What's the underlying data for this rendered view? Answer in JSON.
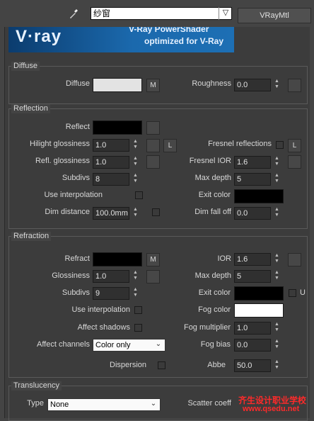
{
  "header": {
    "material_name": "纱窗",
    "material_type": "VRayMtl"
  },
  "banner": {
    "logo": "V·ray",
    "top_text": "V-Ray PowerShader",
    "subtitle": "optimized for V-Ray"
  },
  "diffuse": {
    "title": "Diffuse",
    "diffuse_label": "Diffuse",
    "diffuse_map": "M",
    "roughness_label": "Roughness",
    "roughness": "0.0",
    "diffuse_color": "#e3e3e3"
  },
  "reflection": {
    "title": "Reflection",
    "reflect_label": "Reflect",
    "reflect_color": "#000000",
    "hilight_label": "Hilight glossiness",
    "hilight": "1.0",
    "lock": "L",
    "fresnel_label": "Fresnel reflections",
    "fresnel_lock": "L",
    "refl_gloss_label": "Refl. glossiness",
    "refl_gloss": "1.0",
    "fresnel_ior_label": "Fresnel IOR",
    "fresnel_ior": "1.6",
    "subdivs_label": "Subdivs",
    "subdivs": "8",
    "max_depth_label": "Max depth",
    "max_depth": "5",
    "use_interp_label": "Use interpolation",
    "exit_color_label": "Exit color",
    "exit_color": "#000000",
    "dim_distance_label": "Dim distance",
    "dim_distance": "100.0mm",
    "dim_falloff_label": "Dim fall off",
    "dim_falloff": "0.0"
  },
  "refraction": {
    "title": "Refraction",
    "refract_label": "Refract",
    "refract_color": "#000000",
    "refract_map": "M",
    "ior_label": "IOR",
    "ior": "1.6",
    "gloss_label": "Glossiness",
    "gloss": "1.0",
    "max_depth_label": "Max depth",
    "max_depth": "5",
    "subdivs_label": "Subdivs",
    "subdivs": "9",
    "exit_color_label": "Exit color",
    "exit_color": "#000000",
    "exit_u": "U",
    "use_interp_label": "Use interpolation",
    "fog_color_label": "Fog color",
    "fog_color": "#ffffff",
    "affect_shadows_label": "Affect shadows",
    "fog_mult_label": "Fog multiplier",
    "fog_mult": "1.0",
    "affect_channels_label": "Affect channels",
    "affect_channels": "Color only",
    "fog_bias_label": "Fog bias",
    "fog_bias": "0.0",
    "dispersion_label": "Dispersion",
    "abbe_label": "Abbe",
    "abbe": "50.0"
  },
  "translucency": {
    "title": "Translucency",
    "type_label": "Type",
    "type": "None",
    "scatter_label": "Scatter coeff"
  },
  "watermark": {
    "line1": "齐生设计职业学校",
    "line2": "www.qsedu.net"
  }
}
